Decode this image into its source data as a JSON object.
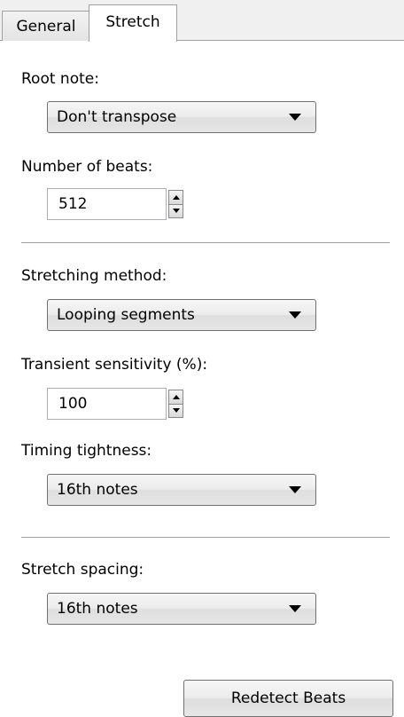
{
  "tabs": {
    "general": "General",
    "stretch": "Stretch",
    "active": "Stretch"
  },
  "root_note": {
    "label": "Root note:",
    "value": "Don't transpose"
  },
  "beats": {
    "label": "Number of beats:",
    "value": "512"
  },
  "stretching_method": {
    "label": "Stretching method:",
    "value": "Looping segments"
  },
  "transient_sensitivity": {
    "label": "Transient sensitivity (%):",
    "value": "100"
  },
  "timing_tightness": {
    "label": "Timing tightness:",
    "value": "16th notes"
  },
  "stretch_spacing": {
    "label": "Stretch spacing:",
    "value": "16th notes"
  },
  "actions": {
    "redetect": "Redetect Beats"
  },
  "icons": {
    "dropdown": "chevron-down-icon",
    "spinner": "spinner-arrows-icon"
  }
}
